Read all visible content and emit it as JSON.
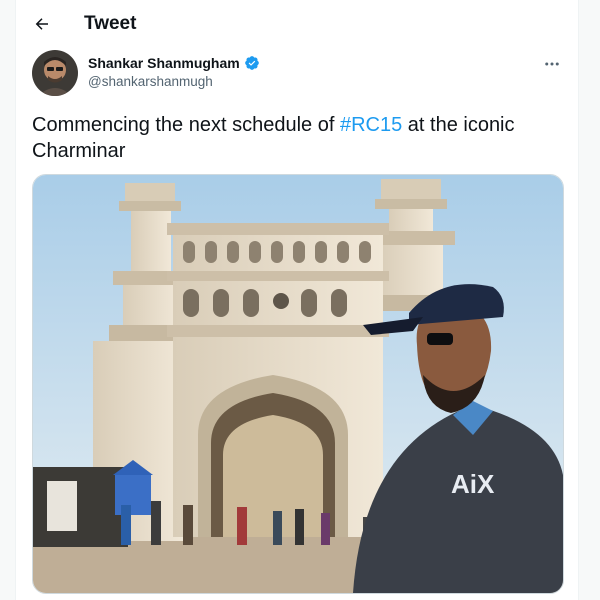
{
  "header": {
    "title": "Tweet",
    "back_icon": "arrow-left-icon"
  },
  "author": {
    "name": "Shankar Shanmugham",
    "handle": "@shankarshanmugh",
    "verified": true,
    "verified_color": "#1d9bf0"
  },
  "tweet": {
    "text_before": "Commencing the next schedule of ",
    "hashtag": "#RC15",
    "text_after": " at the iconic Charminar",
    "hashtag_color": "#1d9bf0"
  },
  "media": {
    "description_icon": "photo-charminar",
    "shirt_logo": "AiX"
  },
  "more_icon": "more-horizontal-icon"
}
